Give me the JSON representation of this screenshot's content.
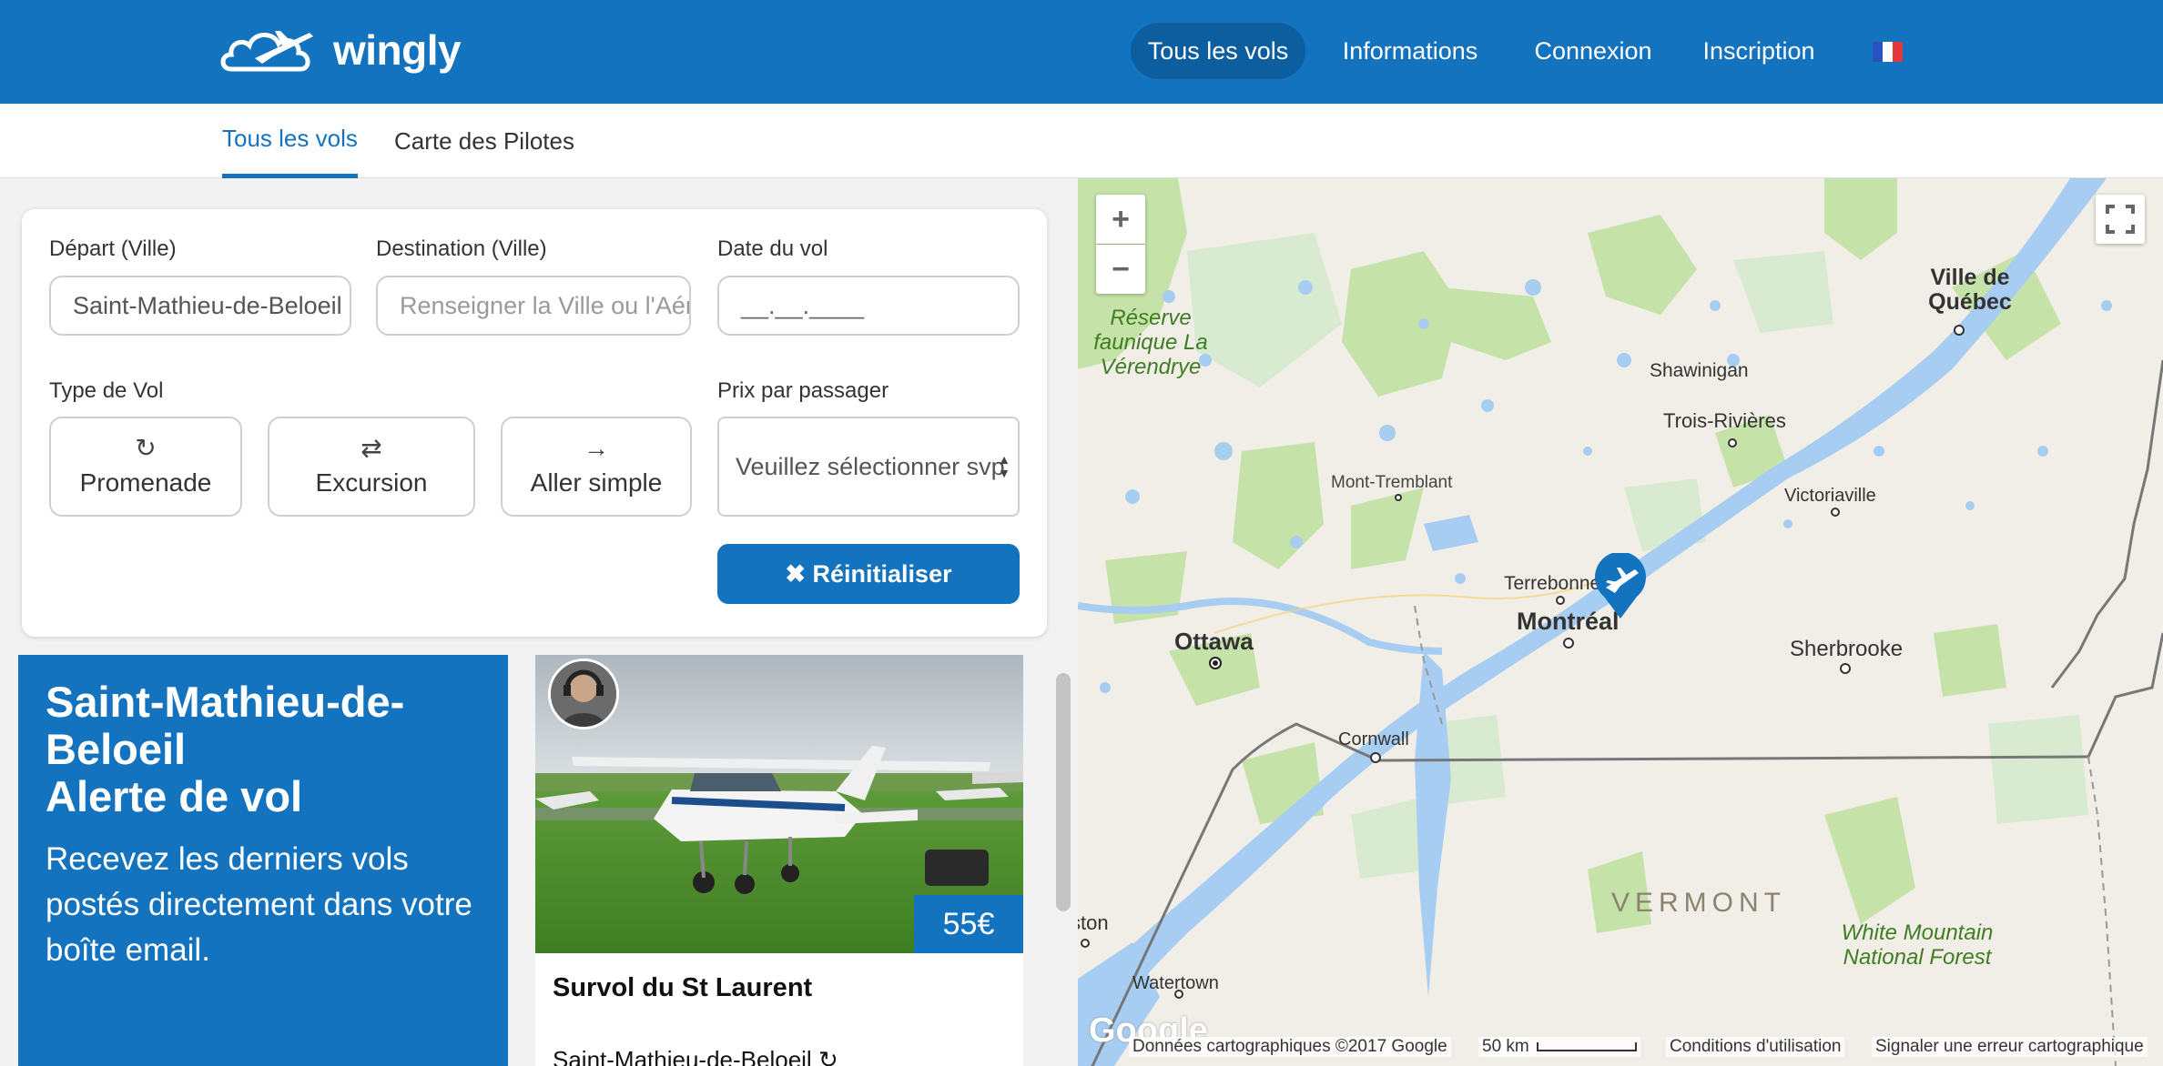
{
  "header": {
    "brand": "wingly",
    "nav": [
      {
        "label": "Tous les vols",
        "active": true
      },
      {
        "label": "Informations"
      },
      {
        "label": "Connexion"
      },
      {
        "label": "Inscription"
      }
    ],
    "language_icon": "french-flag-icon"
  },
  "subnav": {
    "tabs": [
      {
        "label": "Tous les vols",
        "active": true
      },
      {
        "label": "Carte des Pilotes"
      }
    ]
  },
  "search": {
    "departure_label": "Départ (Ville)",
    "departure_value": "Saint-Mathieu-de-Beloeil",
    "destination_label": "Destination (Ville)",
    "destination_placeholder": "Renseigner la Ville ou l'Aéroport",
    "date_label": "Date du vol",
    "date_placeholder": "__.__.____",
    "type_label": "Type de Vol",
    "types": [
      {
        "label": "Promenade",
        "icon": "refresh-icon"
      },
      {
        "label": "Excursion",
        "icon": "exchange-icon"
      },
      {
        "label": "Aller simple",
        "icon": "arrow-right-icon"
      }
    ],
    "price_label": "Prix par passager",
    "price_placeholder": "Veuillez sélectionner svp",
    "reset_label": "✖ Réinitialiser"
  },
  "alert": {
    "title_line1": "Saint-Mathieu-de-Beloeil",
    "title_line2": "Alerte de vol",
    "text": "Recevez les derniers vols postés directement dans votre boîte email."
  },
  "flight": {
    "price": "55€",
    "title": "Survol du St Laurent",
    "subtitle": "Saint-Mathieu-de-Beloeil"
  },
  "map": {
    "zoom_in": "+",
    "zoom_out": "−",
    "fullscreen_icon": "fullscreen-icon",
    "marker_icon": "plane-marker-icon",
    "labels": {
      "quebec": "Ville de Québec",
      "reserve": "Réserve faunique La Vérendrye",
      "shawinigan": "Shawinigan",
      "trois_rivieres": "Trois-Rivières",
      "mont_tremblant": "Mont-Tremblant",
      "victoriaville": "Victoriaville",
      "terrebonne": "Terrebonne",
      "montreal": "Montréal",
      "ottawa": "Ottawa",
      "sherbrooke": "Sherbrooke",
      "cornwall": "Cornwall",
      "vermont": "VERMONT",
      "kingston": "Kingston",
      "watertown": "Watertown",
      "white_mountain": "White Mountain National Forest"
    },
    "google": "Google",
    "footer": {
      "data": "Données cartographiques ©2017 Google",
      "scale": "50 km",
      "terms": "Conditions d'utilisation",
      "report": "Signaler une erreur cartographique"
    }
  },
  "colors": {
    "brand": "#1473bf",
    "brand_dark": "#0d5e9f"
  }
}
